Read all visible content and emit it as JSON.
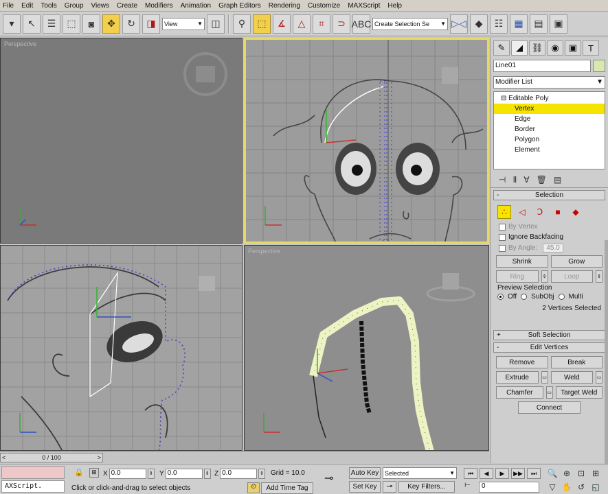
{
  "menu": [
    "File",
    "Edit",
    "Tools",
    "Group",
    "Views",
    "Create",
    "Modifiers",
    "Animation",
    "Graph Editors",
    "Rendering",
    "Customize",
    "MAXScript",
    "Help"
  ],
  "toolbar": {
    "ref_coord": "View",
    "selection_set": "Create Selection Se"
  },
  "viewports": {
    "top_left_label": "Perspective",
    "bottom_right_label": "Perspective"
  },
  "panel": {
    "object_name": "Line01",
    "modifier_list": "Modifier List",
    "stack": [
      {
        "label": "Editable Poly",
        "type": "root"
      },
      {
        "label": "Vertex",
        "type": "sub",
        "selected": true
      },
      {
        "label": "Edge",
        "type": "sub"
      },
      {
        "label": "Border",
        "type": "sub"
      },
      {
        "label": "Polygon",
        "type": "sub"
      },
      {
        "label": "Element",
        "type": "sub"
      }
    ],
    "selection": {
      "title": "Selection",
      "by_vertex": "By Vertex",
      "ignore_backfacing": "Ignore Backfacing",
      "by_angle": "By Angle:",
      "by_angle_value": "45.0",
      "shrink": "Shrink",
      "grow": "Grow",
      "ring": "Ring",
      "loop": "Loop",
      "preview_label": "Preview Selection",
      "preview_off": "Off",
      "preview_subobj": "SubObj",
      "preview_multi": "Multi",
      "status": "2 Vertices Selected"
    },
    "soft_selection": "Soft Selection",
    "edit_vertices": {
      "title": "Edit Vertices",
      "remove": "Remove",
      "break": "Break",
      "extrude": "Extrude",
      "weld": "Weld",
      "chamfer": "Chamfer",
      "target_weld": "Target Weld",
      "connect": "Connect"
    }
  },
  "timeline": {
    "frame": "0 / 100"
  },
  "status": {
    "maxscript": "AXScript.",
    "prompt": "Click or click-and-drag to select objects",
    "x_label": "X",
    "y_label": "Y",
    "z_label": "Z",
    "x": "0.0",
    "y": "0.0",
    "z": "0.0",
    "grid": "Grid = 10.0",
    "auto_key": "Auto Key",
    "set_key": "Set Key",
    "key_mode": "Selected",
    "key_filters": "Key Filters...",
    "add_time_tag": "Add Time Tag",
    "current_frame": "0"
  }
}
